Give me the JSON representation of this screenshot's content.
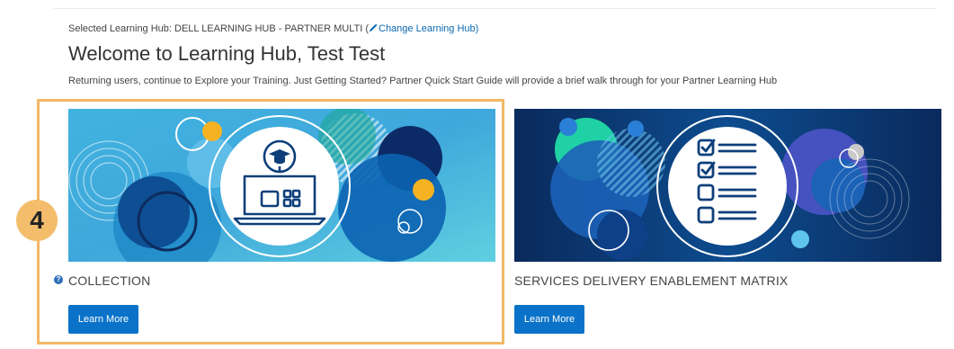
{
  "header": {
    "selected_hub_prefix": "Selected Learning Hub: DELL LEARNING HUB - PARTNER MULTI (",
    "change_hub_link": "Change Learning Hub",
    "selected_hub_suffix": ")",
    "welcome_title": "Welcome to Learning Hub, Test Test",
    "subtitle": "Returning users, continue to Explore your Training. Just Getting Started? Partner Quick Start Guide will provide a brief walk through for your Partner Learning Hub"
  },
  "step_badge": "4",
  "cards": [
    {
      "title": "COLLECTION",
      "button_label": "Learn More",
      "image_icon": "graduation-laptop-icon",
      "help_icon": "?"
    },
    {
      "title": "SERVICES DELIVERY ENABLEMENT MATRIX",
      "button_label": "Learn More",
      "image_icon": "checklist-icon"
    }
  ],
  "colors": {
    "accent_blue": "#0a72c8",
    "link_blue": "#0a6ab3",
    "highlight_border": "#f2b866",
    "badge_fill": "#f3bd6c"
  }
}
